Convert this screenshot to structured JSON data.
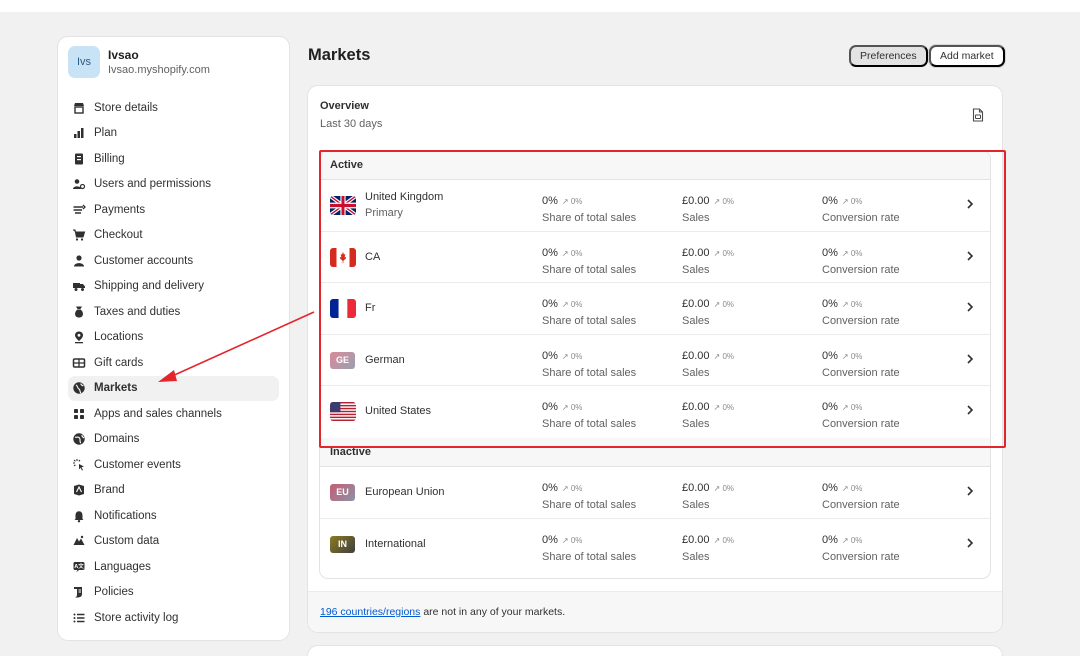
{
  "store": {
    "avatar_text": "Ivs",
    "name": "Ivsao",
    "domain": "Ivsao.myshopify.com"
  },
  "sidebar": {
    "items": [
      {
        "label": "Store details",
        "icon": "store-icon"
      },
      {
        "label": "Plan",
        "icon": "plan-icon"
      },
      {
        "label": "Billing",
        "icon": "billing-icon"
      },
      {
        "label": "Users and permissions",
        "icon": "users-icon"
      },
      {
        "label": "Payments",
        "icon": "payments-icon"
      },
      {
        "label": "Checkout",
        "icon": "cart-icon"
      },
      {
        "label": "Customer accounts",
        "icon": "person-icon"
      },
      {
        "label": "Shipping and delivery",
        "icon": "truck-icon"
      },
      {
        "label": "Taxes and duties",
        "icon": "taxes-icon"
      },
      {
        "label": "Locations",
        "icon": "location-pin-icon"
      },
      {
        "label": "Gift cards",
        "icon": "gift-card-icon"
      },
      {
        "label": "Markets",
        "icon": "globe-icon",
        "active": true
      },
      {
        "label": "Apps and sales channels",
        "icon": "apps-icon"
      },
      {
        "label": "Domains",
        "icon": "domain-globe-icon"
      },
      {
        "label": "Customer events",
        "icon": "cursor-click-icon"
      },
      {
        "label": "Brand",
        "icon": "brand-icon"
      },
      {
        "label": "Notifications",
        "icon": "bell-icon"
      },
      {
        "label": "Custom data",
        "icon": "custom-data-icon"
      },
      {
        "label": "Languages",
        "icon": "languages-icon"
      },
      {
        "label": "Policies",
        "icon": "policies-icon"
      },
      {
        "label": "Store activity log",
        "icon": "list-icon"
      }
    ]
  },
  "header": {
    "title": "Markets",
    "preferences_label": "Preferences",
    "add_market_label": "Add market"
  },
  "overview": {
    "title": "Overview",
    "subtitle": "Last 30 days"
  },
  "metric_labels": {
    "share": "Share of total sales",
    "sales": "Sales",
    "conversion": "Conversion rate"
  },
  "sections": {
    "active_title": "Active",
    "inactive_title": "Inactive"
  },
  "active_markets": [
    {
      "name": "United Kingdom",
      "sub": "Primary",
      "icon": "uk-flag-icon",
      "share": "0%",
      "share_delta": "↗ 0%",
      "sales": "£0.00",
      "sales_delta": "↗ 0%",
      "conversion": "0%",
      "conversion_delta": "↗ 0%"
    },
    {
      "name": "CA",
      "sub": "",
      "icon": "canada-flag-icon",
      "share": "0%",
      "share_delta": "↗ 0%",
      "sales": "£0.00",
      "sales_delta": "↗ 0%",
      "conversion": "0%",
      "conversion_delta": "↗ 0%"
    },
    {
      "name": "Fr",
      "sub": "",
      "icon": "france-flag-icon",
      "share": "0%",
      "share_delta": "↗ 0%",
      "sales": "£0.00",
      "sales_delta": "↗ 0%",
      "conversion": "0%",
      "conversion_delta": "↗ 0%"
    },
    {
      "name": "German",
      "sub": "",
      "icon": "badge-icon",
      "badge": "GE",
      "share": "0%",
      "share_delta": "↗ 0%",
      "sales": "£0.00",
      "sales_delta": "↗ 0%",
      "conversion": "0%",
      "conversion_delta": "↗ 0%"
    },
    {
      "name": "United States",
      "sub": "",
      "icon": "us-flag-icon",
      "share": "0%",
      "share_delta": "↗ 0%",
      "sales": "£0.00",
      "sales_delta": "↗ 0%",
      "conversion": "0%",
      "conversion_delta": "↗ 0%"
    }
  ],
  "inactive_markets": [
    {
      "name": "European Union",
      "sub": "",
      "icon": "badge-icon",
      "badge": "EU",
      "share": "0%",
      "share_delta": "↗ 0%",
      "sales": "£0.00",
      "sales_delta": "↗ 0%",
      "conversion": "0%",
      "conversion_delta": "↗ 0%"
    },
    {
      "name": "International",
      "sub": "",
      "icon": "badge-icon",
      "badge": "IN",
      "share": "0%",
      "share_delta": "↗ 0%",
      "sales": "£0.00",
      "sales_delta": "↗ 0%",
      "conversion": "0%",
      "conversion_delta": "↗ 0%"
    }
  ],
  "footer": {
    "link_text": "196 countries/regions",
    "rest_text": " are not in any of your markets."
  },
  "colors": {
    "annotation_red": "#e3262b",
    "link_blue": "#005bd3",
    "badge_ge": "#c4707c",
    "badge_eu": "#b9576c",
    "badge_in": "#8b7a22"
  }
}
